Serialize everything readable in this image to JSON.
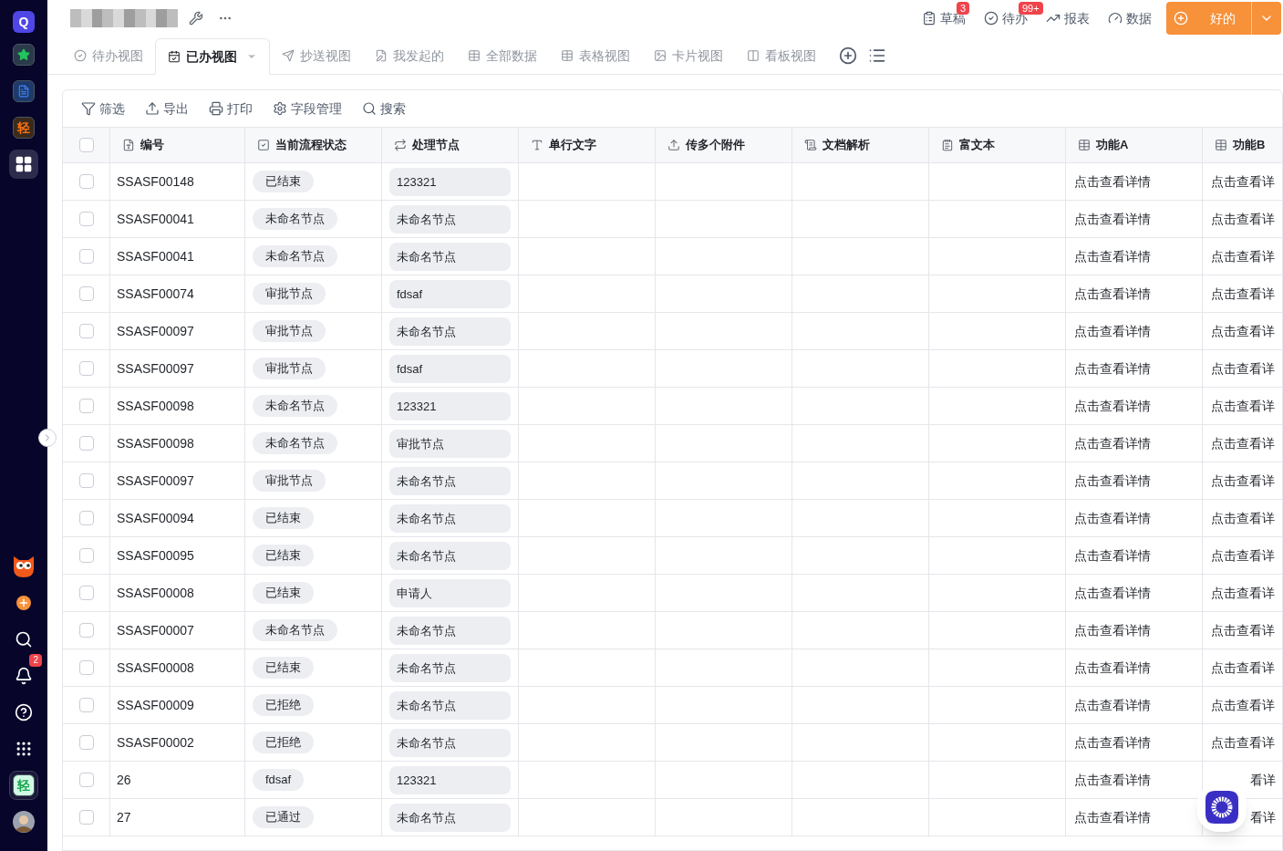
{
  "sidebar": {
    "logo": "Q",
    "apps": [
      {
        "kind": "star",
        "selected": false
      },
      {
        "kind": "doc",
        "selected": false
      },
      {
        "kind": "text",
        "label": "轻",
        "selected": false
      },
      {
        "kind": "grid",
        "selected": true
      }
    ],
    "bottom": [
      {
        "kind": "owl"
      },
      {
        "kind": "plus"
      },
      {
        "kind": "search"
      },
      {
        "kind": "bell",
        "badge": "2"
      },
      {
        "kind": "help"
      },
      {
        "kind": "dots"
      },
      {
        "kind": "text",
        "label": "轻"
      },
      {
        "kind": "avatar"
      }
    ]
  },
  "header": {
    "actions": [
      {
        "kind": "draft",
        "label": "草稿",
        "badge": "3"
      },
      {
        "kind": "todo",
        "label": "待办",
        "badge": "99+"
      },
      {
        "kind": "report",
        "label": "报表"
      },
      {
        "kind": "data",
        "label": "数据"
      }
    ],
    "primary_button": "好的"
  },
  "tabs": [
    {
      "kind": "check",
      "label": "待办视图",
      "selected": false
    },
    {
      "kind": "calendar",
      "label": "已办视图",
      "selected": true
    },
    {
      "kind": "send",
      "label": "抄送视图",
      "selected": false
    },
    {
      "kind": "form",
      "label": "我发起的",
      "selected": false
    },
    {
      "kind": "table",
      "label": "全部数据",
      "selected": false
    },
    {
      "kind": "table",
      "label": "表格视图",
      "selected": false
    },
    {
      "kind": "card",
      "label": "卡片视图",
      "selected": false
    },
    {
      "kind": "board",
      "label": "看板视图",
      "selected": false
    }
  ],
  "toolbar": [
    {
      "kind": "filter",
      "label": "筛选"
    },
    {
      "kind": "export",
      "label": "导出"
    },
    {
      "kind": "print",
      "label": "打印"
    },
    {
      "kind": "fields",
      "label": "字段管理"
    },
    {
      "kind": "search",
      "label": "搜索"
    }
  ],
  "table": {
    "select_all_checked": false,
    "columns": [
      {
        "kind": "number",
        "label": "编号"
      },
      {
        "kind": "check",
        "label": "当前流程状态"
      },
      {
        "kind": "flow",
        "label": "处理节点"
      },
      {
        "kind": "text",
        "label": "单行文字"
      },
      {
        "kind": "upload",
        "label": "传多个附件"
      },
      {
        "kind": "doc",
        "label": "文档解析"
      },
      {
        "kind": "rich",
        "label": "富文本"
      },
      {
        "kind": "table",
        "label": "功能A"
      },
      {
        "kind": "table",
        "label": "功能B"
      }
    ],
    "rows": [
      {
        "checked": false,
        "id": "SSASF00148",
        "status": "已结束",
        "node": "123321",
        "a": "点击查看详情",
        "b": "点击查看详"
      },
      {
        "checked": false,
        "id": "SSASF00041",
        "status": "未命名节点",
        "node": "未命名节点",
        "a": "点击查看详情",
        "b": "点击查看详"
      },
      {
        "checked": false,
        "id": "SSASF00041",
        "status": "未命名节点",
        "node": "未命名节点",
        "a": "点击查看详情",
        "b": "点击查看详"
      },
      {
        "checked": false,
        "id": "SSASF00074",
        "status": "审批节点",
        "node": "fdsaf",
        "a": "点击查看详情",
        "b": "点击查看详"
      },
      {
        "checked": false,
        "id": "SSASF00097",
        "status": "审批节点",
        "node": "未命名节点",
        "a": "点击查看详情",
        "b": "点击查看详"
      },
      {
        "checked": false,
        "id": "SSASF00097",
        "status": "审批节点",
        "node": "fdsaf",
        "a": "点击查看详情",
        "b": "点击查看详"
      },
      {
        "checked": false,
        "id": "SSASF00098",
        "status": "未命名节点",
        "node": "123321",
        "a": "点击查看详情",
        "b": "点击查看详"
      },
      {
        "checked": false,
        "id": "SSASF00098",
        "status": "未命名节点",
        "node": "审批节点",
        "a": "点击查看详情",
        "b": "点击查看详"
      },
      {
        "checked": false,
        "id": "SSASF00097",
        "status": "审批节点",
        "node": "未命名节点",
        "a": "点击查看详情",
        "b": "点击查看详"
      },
      {
        "checked": false,
        "id": "SSASF00094",
        "status": "已结束",
        "node": "未命名节点",
        "a": "点击查看详情",
        "b": "点击查看详"
      },
      {
        "checked": false,
        "id": "SSASF00095",
        "status": "已结束",
        "node": "未命名节点",
        "a": "点击查看详情",
        "b": "点击查看详"
      },
      {
        "checked": false,
        "id": "SSASF00008",
        "status": "已结束",
        "node": "申请人",
        "a": "点击查看详情",
        "b": "点击查看详"
      },
      {
        "checked": false,
        "id": "SSASF00007",
        "status": "未命名节点",
        "node": "未命名节点",
        "a": "点击查看详情",
        "b": "点击查看详"
      },
      {
        "checked": false,
        "id": "SSASF00008",
        "status": "已结束",
        "node": "未命名节点",
        "a": "点击查看详情",
        "b": "点击查看详"
      },
      {
        "checked": false,
        "id": "SSASF00009",
        "status": "已拒绝",
        "node": "未命名节点",
        "a": "点击查看详情",
        "b": "点击查看详"
      },
      {
        "checked": false,
        "id": "SSASF00002",
        "status": "已拒绝",
        "node": "未命名节点",
        "a": "点击查看详情",
        "b": "点击查看详"
      },
      {
        "checked": false,
        "id": "26",
        "status": "fdsaf",
        "node": "123321",
        "a": "点击查看详情",
        "b": "看详"
      },
      {
        "checked": false,
        "id": "27",
        "status": "已通过",
        "node": "未命名节点",
        "a": "点击查看详情",
        "b": "看详"
      }
    ]
  }
}
